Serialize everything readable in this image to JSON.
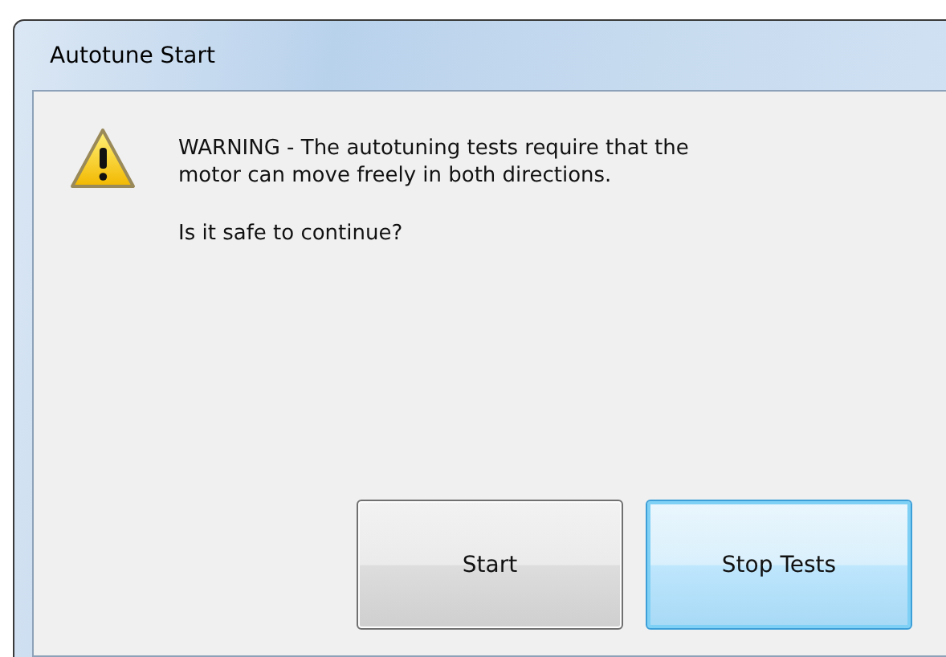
{
  "window": {
    "title": "Autotune Start"
  },
  "message": {
    "text": "WARNING - The autotuning tests require that the motor can move freely in both directions.",
    "question": "Is it safe to continue?"
  },
  "buttons": [
    {
      "label": "Start",
      "default": false
    },
    {
      "label": "Stop Tests",
      "default": true
    }
  ]
}
